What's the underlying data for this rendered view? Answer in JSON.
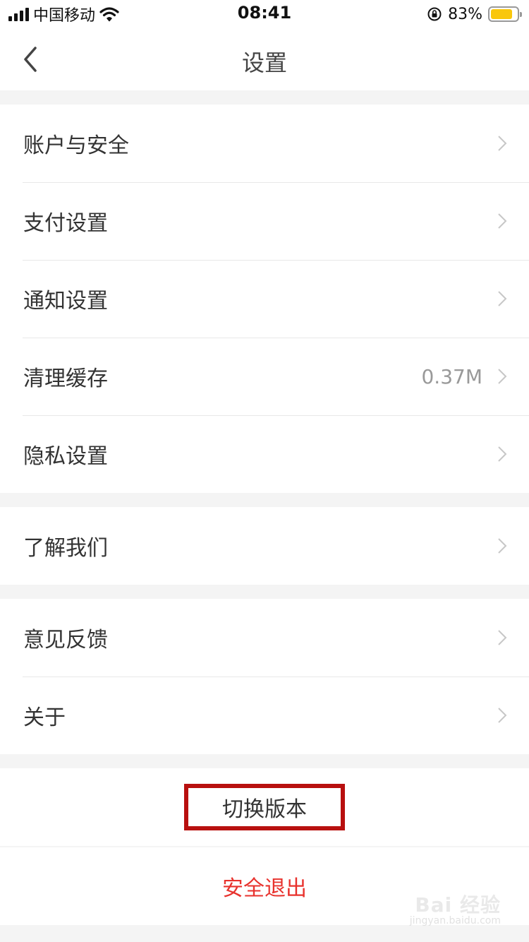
{
  "status_bar": {
    "carrier": "中国移动",
    "time": "08:41",
    "battery": "83%",
    "battery_level": 0.83,
    "battery_color": "#f9c70c"
  },
  "nav": {
    "title": "设置",
    "back_icon": "chevron-left-icon"
  },
  "groups": [
    {
      "items": [
        {
          "label": "账户与安全",
          "value": ""
        },
        {
          "label": "支付设置",
          "value": ""
        },
        {
          "label": "通知设置",
          "value": ""
        },
        {
          "label": "清理缓存",
          "value": "0.37M"
        },
        {
          "label": "隐私设置",
          "value": ""
        }
      ]
    },
    {
      "items": [
        {
          "label": "了解我们",
          "value": ""
        }
      ]
    },
    {
      "items": [
        {
          "label": "意见反馈",
          "value": ""
        },
        {
          "label": "关于",
          "value": ""
        }
      ]
    }
  ],
  "switch_version": {
    "label": "切换版本",
    "highlight_color": "#b8100f"
  },
  "logout": {
    "label": "安全退出",
    "color": "#e8322d"
  },
  "watermark": {
    "main": "Bai 经验",
    "sub": "jingyan.baidu.com"
  }
}
